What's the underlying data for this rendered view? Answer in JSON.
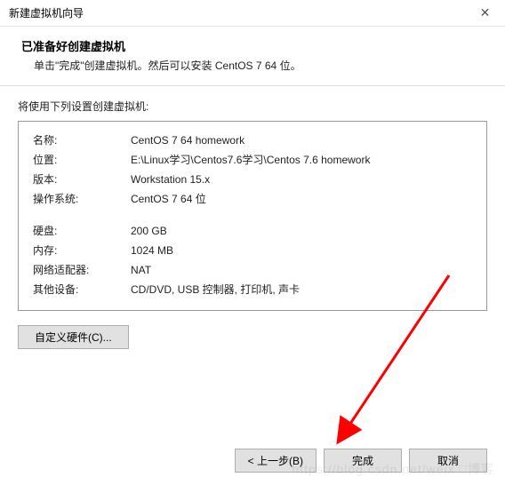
{
  "titlebar": {
    "title": "新建虚拟机向导",
    "close_icon": "✕"
  },
  "header": {
    "title": "已准备好创建虚拟机",
    "subtitle": "单击\"完成\"创建虚拟机。然后可以安装 CentOS 7 64 位。"
  },
  "section_label": "将使用下列设置创建虚拟机:",
  "summary": {
    "rows1": [
      {
        "label": "名称:",
        "value": "CentOS 7 64  homework"
      },
      {
        "label": "位置:",
        "value": "E:\\Linux学习\\Centos7.6学习\\Centos 7.6 homework"
      },
      {
        "label": "版本:",
        "value": "Workstation 15.x"
      },
      {
        "label": "操作系统:",
        "value": "CentOS 7 64 位"
      }
    ],
    "rows2": [
      {
        "label": "硬盘:",
        "value": "200 GB"
      },
      {
        "label": "内存:",
        "value": "1024 MB"
      },
      {
        "label": "网络适配器:",
        "value": "NAT"
      },
      {
        "label": "其他设备:",
        "value": "CD/DVD, USB 控制器, 打印机, 声卡"
      }
    ]
  },
  "buttons": {
    "customize": "自定义硬件(C)...",
    "back": "< 上一步(B)",
    "finish": "完成",
    "cancel": "取消"
  },
  "watermark": "https://blog.csdn.net/weix  □博客"
}
